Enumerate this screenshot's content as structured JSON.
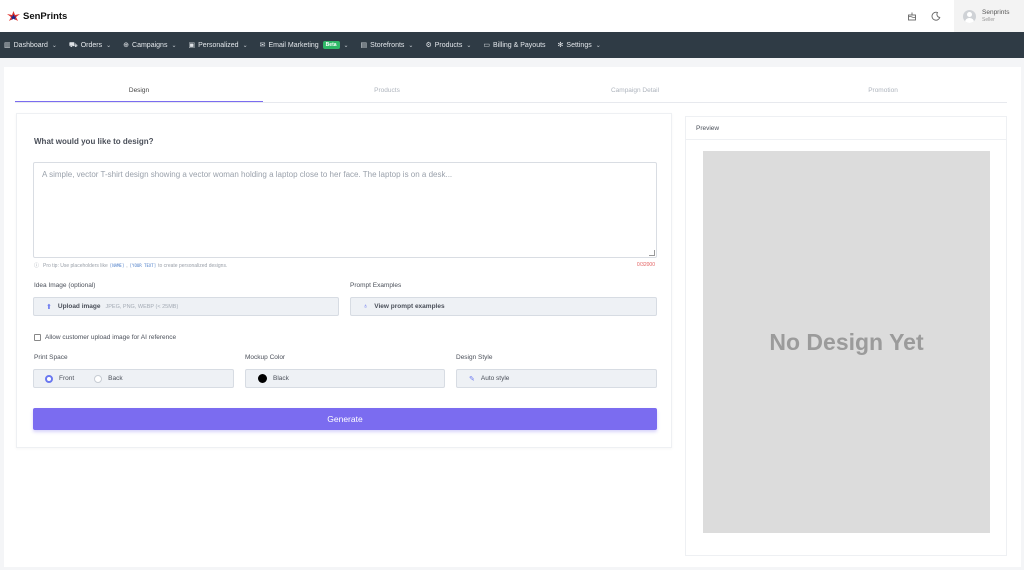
{
  "app": {
    "logo_text": "SenPrints"
  },
  "header": {
    "user_name": "Senprints",
    "user_role": "Seller",
    "icons": [
      "cake-icon",
      "moon-icon"
    ]
  },
  "nav": {
    "items": [
      {
        "label": "Dashboard",
        "icon": "chart-icon",
        "has_dropdown": true
      },
      {
        "label": "Orders",
        "icon": "cart-icon",
        "has_dropdown": true
      },
      {
        "label": "Campaigns",
        "icon": "globe-icon",
        "has_dropdown": true
      },
      {
        "label": "Personalized",
        "icon": "image-icon",
        "has_dropdown": true
      },
      {
        "label": "Email Marketing",
        "icon": "mail-icon",
        "has_dropdown": true,
        "badge": "Beta"
      },
      {
        "label": "Storefronts",
        "icon": "store-icon",
        "has_dropdown": true
      },
      {
        "label": "Products",
        "icon": "settings-icon",
        "has_dropdown": true
      },
      {
        "label": "Billing & Payouts",
        "icon": "credit-card-icon",
        "has_dropdown": false
      },
      {
        "label": "Settings",
        "icon": "gear-icon",
        "has_dropdown": true
      }
    ]
  },
  "steps": [
    {
      "label": "Design",
      "active": true
    },
    {
      "label": "Products",
      "active": false
    },
    {
      "label": "Campaign Detail",
      "active": false
    },
    {
      "label": "Promotion",
      "active": false
    }
  ],
  "design_form": {
    "question": "What would you like to design?",
    "prompt_placeholder": "A simple, vector T-shirt design showing a vector woman holding a laptop close to her face. The laptop is on a desk...",
    "tip_prefix": "Pro tip: Use placeholders like",
    "tip_code1": "[NAME]",
    "tip_code2": "[YOUR TEXT]",
    "tip_suffix": "to create personalized designs.",
    "char_count": "0/32000",
    "idea_image_label": "Idea Image (optional)",
    "upload_button": "Upload image",
    "upload_hint": "JPEG, PNG, WEBP (< 25MB)",
    "prompt_examples_label": "Prompt Examples",
    "view_examples_button": "View prompt examples",
    "allow_upload_label": "Allow customer upload image for AI reference",
    "print_space_label": "Print Space",
    "print_front": "Front",
    "print_back": "Back",
    "print_selected": "Front",
    "mockup_color_label": "Mockup Color",
    "mockup_color_value": "Black",
    "mockup_color_hex": "#000000",
    "design_style_label": "Design Style",
    "design_style_value": "Auto style",
    "generate_button": "Generate"
  },
  "preview": {
    "title": "Preview",
    "empty_text": "No Design Yet"
  },
  "colors": {
    "accent": "#7b6cf0",
    "nav_bg": "#2f3b45",
    "beta": "#2fb867",
    "counter": "#e35d5d"
  }
}
